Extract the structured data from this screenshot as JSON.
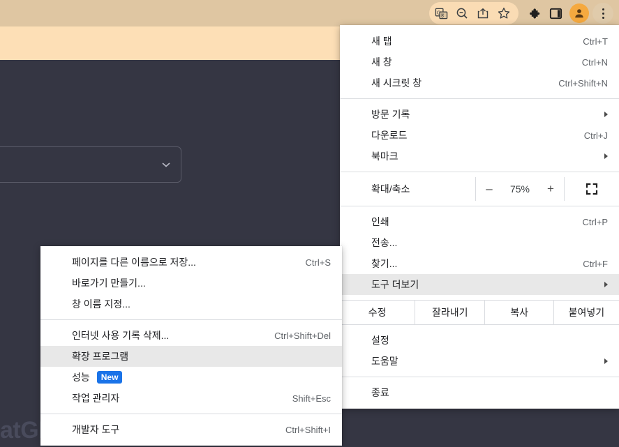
{
  "browser": {
    "toolbar_icons": [
      {
        "name": "translate-icon",
        "label": "번역"
      },
      {
        "name": "zoom-out-icon",
        "label": "축소"
      },
      {
        "name": "share-icon",
        "label": "공유"
      },
      {
        "name": "bookmark-star-icon",
        "label": "북마크 추가"
      },
      {
        "name": "extensions-puzzle-icon",
        "label": "확장 프로그램"
      },
      {
        "name": "side-panel-icon",
        "label": "사이드 패널"
      },
      {
        "name": "profile-avatar-icon",
        "label": "프로필"
      },
      {
        "name": "chrome-menu-icon",
        "label": "Chrome 맞춤설정 및 제어"
      }
    ],
    "colors": {
      "toolbar_bg": "#dfc6a2",
      "omnibox_band": "#fddfb6",
      "page_bg": "#353643",
      "avatar": "#f5a93f",
      "accent_blue": "#1a73e8"
    }
  },
  "page": {
    "ghost_text": "atGP",
    "select_value": ""
  },
  "main_menu": {
    "groups": [
      {
        "items": [
          {
            "label": "새 탭",
            "accel": "Ctrl+T",
            "arrow": false,
            "name": "menu-item-new-tab"
          },
          {
            "label": "새 창",
            "accel": "Ctrl+N",
            "arrow": false,
            "name": "menu-item-new-window"
          },
          {
            "label": "새 시크릿 창",
            "accel": "Ctrl+Shift+N",
            "arrow": false,
            "name": "menu-item-new-incognito-window"
          }
        ]
      },
      {
        "items": [
          {
            "label": "방문 기록",
            "accel": "",
            "arrow": true,
            "name": "menu-item-history"
          },
          {
            "label": "다운로드",
            "accel": "Ctrl+J",
            "arrow": false,
            "name": "menu-item-downloads"
          },
          {
            "label": "북마크",
            "accel": "",
            "arrow": true,
            "name": "menu-item-bookmarks"
          }
        ]
      }
    ],
    "zoom": {
      "label": "확대/축소",
      "minus": "–",
      "value": "75%",
      "plus": "+",
      "fullscreen_name": "fullscreen-icon"
    },
    "group3": [
      {
        "label": "인쇄",
        "accel": "Ctrl+P",
        "arrow": false,
        "name": "menu-item-print"
      },
      {
        "label": "전송...",
        "accel": "",
        "arrow": false,
        "name": "menu-item-cast"
      },
      {
        "label": "찾기...",
        "accel": "Ctrl+F",
        "arrow": false,
        "name": "menu-item-find"
      },
      {
        "label": "도구 더보기",
        "accel": "",
        "arrow": true,
        "highlight": true,
        "name": "menu-item-more-tools"
      }
    ],
    "edit_row": {
      "label": "수정",
      "cut": "잘라내기",
      "copy": "복사",
      "paste": "붙여넣기"
    },
    "group4": [
      {
        "label": "설정",
        "accel": "",
        "arrow": false,
        "name": "menu-item-settings"
      },
      {
        "label": "도움말",
        "accel": "",
        "arrow": true,
        "name": "menu-item-help"
      }
    ],
    "group5": [
      {
        "label": "종료",
        "accel": "",
        "arrow": false,
        "name": "menu-item-exit"
      }
    ]
  },
  "sub_menu": {
    "group1": [
      {
        "label": "페이지를 다른 이름으로 저장...",
        "accel": "Ctrl+S",
        "name": "submenu-item-save-page-as"
      },
      {
        "label": "바로가기 만들기...",
        "accel": "",
        "name": "submenu-item-create-shortcut"
      },
      {
        "label": "창 이름 지정...",
        "accel": "",
        "name": "submenu-item-name-window"
      }
    ],
    "group2": [
      {
        "label": "인터넷 사용 기록 삭제...",
        "accel": "Ctrl+Shift+Del",
        "name": "submenu-item-clear-browsing-data"
      },
      {
        "label": "확장 프로그램",
        "accel": "",
        "highlight": true,
        "name": "submenu-item-extensions"
      },
      {
        "label": "성능",
        "accel": "",
        "badge": "New",
        "name": "submenu-item-performance"
      },
      {
        "label": "작업 관리자",
        "accel": "Shift+Esc",
        "name": "submenu-item-task-manager"
      }
    ],
    "group3": [
      {
        "label": "개발자 도구",
        "accel": "Ctrl+Shift+I",
        "name": "submenu-item-developer-tools"
      }
    ]
  }
}
